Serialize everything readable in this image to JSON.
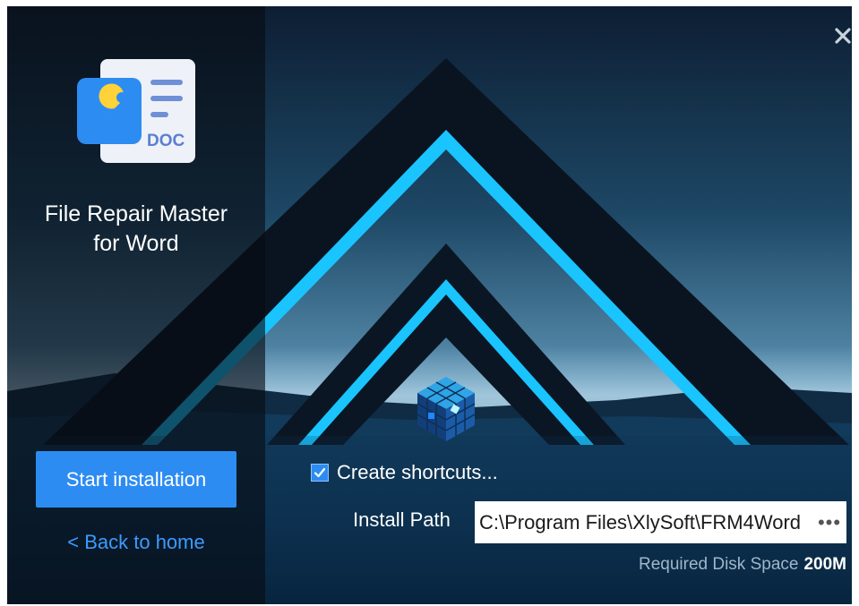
{
  "app": {
    "title_line1": "File Repair Master",
    "title_line2": "for Word",
    "logo_badge": "DOC"
  },
  "actions": {
    "start_label": "Start installation",
    "back_label": "< Back to home"
  },
  "options": {
    "create_shortcuts_label": "Create shortcuts...",
    "create_shortcuts_checked": true
  },
  "install": {
    "path_label": "Install Path",
    "path_value": "C:\\Program Files\\XlySoft\\FRM4Word",
    "browse_label": "•••"
  },
  "disk": {
    "label": "Required Disk Space",
    "value": "200M"
  },
  "icons": {
    "close": "close-icon",
    "logo": "app-logo-icon",
    "cube": "cube-icon",
    "check": "checkmark-icon"
  },
  "colors": {
    "accent": "#2d8cf2",
    "link": "#3d9bff",
    "neon": "#19c4ff"
  }
}
